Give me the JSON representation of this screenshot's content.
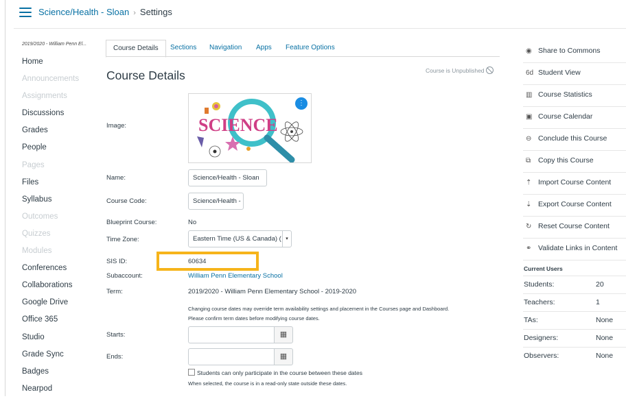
{
  "header": {
    "course_link": "Science/Health - Sloan",
    "separator": "›",
    "current": "Settings"
  },
  "nav": {
    "term": "2019/2020 - William Penn El...",
    "items": [
      {
        "label": "Home",
        "enabled": true
      },
      {
        "label": "Announcements",
        "enabled": false
      },
      {
        "label": "Assignments",
        "enabled": false
      },
      {
        "label": "Discussions",
        "enabled": true
      },
      {
        "label": "Grades",
        "enabled": true
      },
      {
        "label": "People",
        "enabled": true
      },
      {
        "label": "Pages",
        "enabled": false
      },
      {
        "label": "Files",
        "enabled": true
      },
      {
        "label": "Syllabus",
        "enabled": true
      },
      {
        "label": "Outcomes",
        "enabled": false
      },
      {
        "label": "Quizzes",
        "enabled": false
      },
      {
        "label": "Modules",
        "enabled": false
      },
      {
        "label": "Conferences",
        "enabled": true
      },
      {
        "label": "Collaborations",
        "enabled": true
      },
      {
        "label": "Google Drive",
        "enabled": true
      },
      {
        "label": "Office 365",
        "enabled": true
      },
      {
        "label": "Studio",
        "enabled": true
      },
      {
        "label": "Grade Sync",
        "enabled": true
      },
      {
        "label": "Badges",
        "enabled": true
      },
      {
        "label": "Nearpod",
        "enabled": true
      }
    ]
  },
  "tabs": [
    "Course Details",
    "Sections",
    "Navigation",
    "Apps",
    "Feature Options"
  ],
  "details": {
    "title": "Course Details",
    "status": "Course is Unpublished",
    "image_label": "Image:",
    "image_text": "SCIENCE",
    "image_menu": "⋮",
    "name_label": "Name:",
    "name_value": "Science/Health - Sloan",
    "code_label": "Course Code:",
    "code_value": "Science/Health -",
    "blueprint_label": "Blueprint Course:",
    "blueprint_value": "No",
    "tz_label": "Time Zone:",
    "tz_value": "Eastern Time (US & Canada) (",
    "sis_label": "SIS ID:",
    "sis_value": "60634",
    "subaccount_label": "Subaccount:",
    "subaccount_value": "William Penn Elementary School",
    "term_label": "Term:",
    "term_value": "2019/2020 - William Penn Elementary School - 2019-2020",
    "term_note_1": "Changing course dates may override term availability settings and placement in the Courses page and Dashboard.",
    "term_note_2": "Please confirm term dates before modifying course dates.",
    "starts_label": "Starts:",
    "ends_label": "Ends:",
    "restrict_label": "Students can only participate in the course between these dates",
    "restrict_note": "When selected, the course is in a read-only state outside these dates."
  },
  "sidebar": {
    "buttons": [
      {
        "icon": "◉",
        "label": "Share to Commons"
      },
      {
        "icon": "6d",
        "label": "Student View"
      },
      {
        "icon": "▥",
        "label": "Course Statistics"
      },
      {
        "icon": "▣",
        "label": "Course Calendar"
      },
      {
        "icon": "⊖",
        "label": "Conclude this Course"
      },
      {
        "icon": "⧉",
        "label": "Copy this Course"
      },
      {
        "icon": "⇡",
        "label": "Import Course Content"
      },
      {
        "icon": "⇣",
        "label": "Export Course Content"
      },
      {
        "icon": "↻",
        "label": "Reset Course Content"
      },
      {
        "icon": "⚭",
        "label": "Validate Links in Content"
      }
    ],
    "current_users_title": "Current Users",
    "users": [
      {
        "role": "Students:",
        "count": "20"
      },
      {
        "role": "Teachers:",
        "count": "1"
      },
      {
        "role": "TAs:",
        "count": "None"
      },
      {
        "role": "Designers:",
        "count": "None"
      },
      {
        "role": "Observers:",
        "count": "None"
      }
    ]
  },
  "colors": {
    "link": "#0770a3",
    "highlight": "#f6b41a",
    "disabled": "#c7cdd1"
  }
}
